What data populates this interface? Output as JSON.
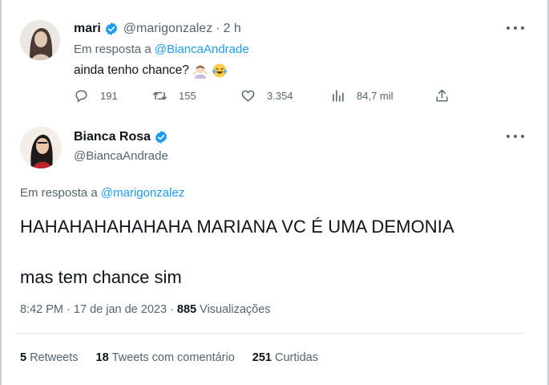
{
  "reply_tweet": {
    "display_name": "mari",
    "handle": "@marigonzalez",
    "separator": "·",
    "time": "2 h",
    "replying_prefix": "Em resposta a",
    "replying_to": "@BiancaAndrade",
    "text": "ainda tenho chance?",
    "emojis": [
      "woman-shrugging-emoji",
      "laughing-tears-emoji"
    ],
    "actions": {
      "replies": "191",
      "retweets": "155",
      "likes": "3.354",
      "views": "84,7 mil"
    }
  },
  "main_tweet": {
    "display_name": "Bianca Rosa",
    "handle": "@BiancaAndrade",
    "replying_prefix": "Em resposta a",
    "replying_to": "@marigonzalez",
    "text_line_1": "HAHAHAHAHAHAHA MARIANA VC É UMA DEMONIA",
    "text_line_2": "mas tem chance sim",
    "time": "8:42 PM",
    "date": "17 de jan de 2023",
    "views_count": "885",
    "views_label": "Visualizações",
    "stats": {
      "retweets_count": "5",
      "retweets_label": "Retweets",
      "quotes_count": "18",
      "quotes_label": "Tweets com comentário",
      "likes_count": "251",
      "likes_label": "Curtidas"
    }
  },
  "colors": {
    "text": "#0f1419",
    "secondary": "#536471",
    "link": "#1d9bf0",
    "verified": "#1d9bf0",
    "divider": "#e2e6ea"
  }
}
